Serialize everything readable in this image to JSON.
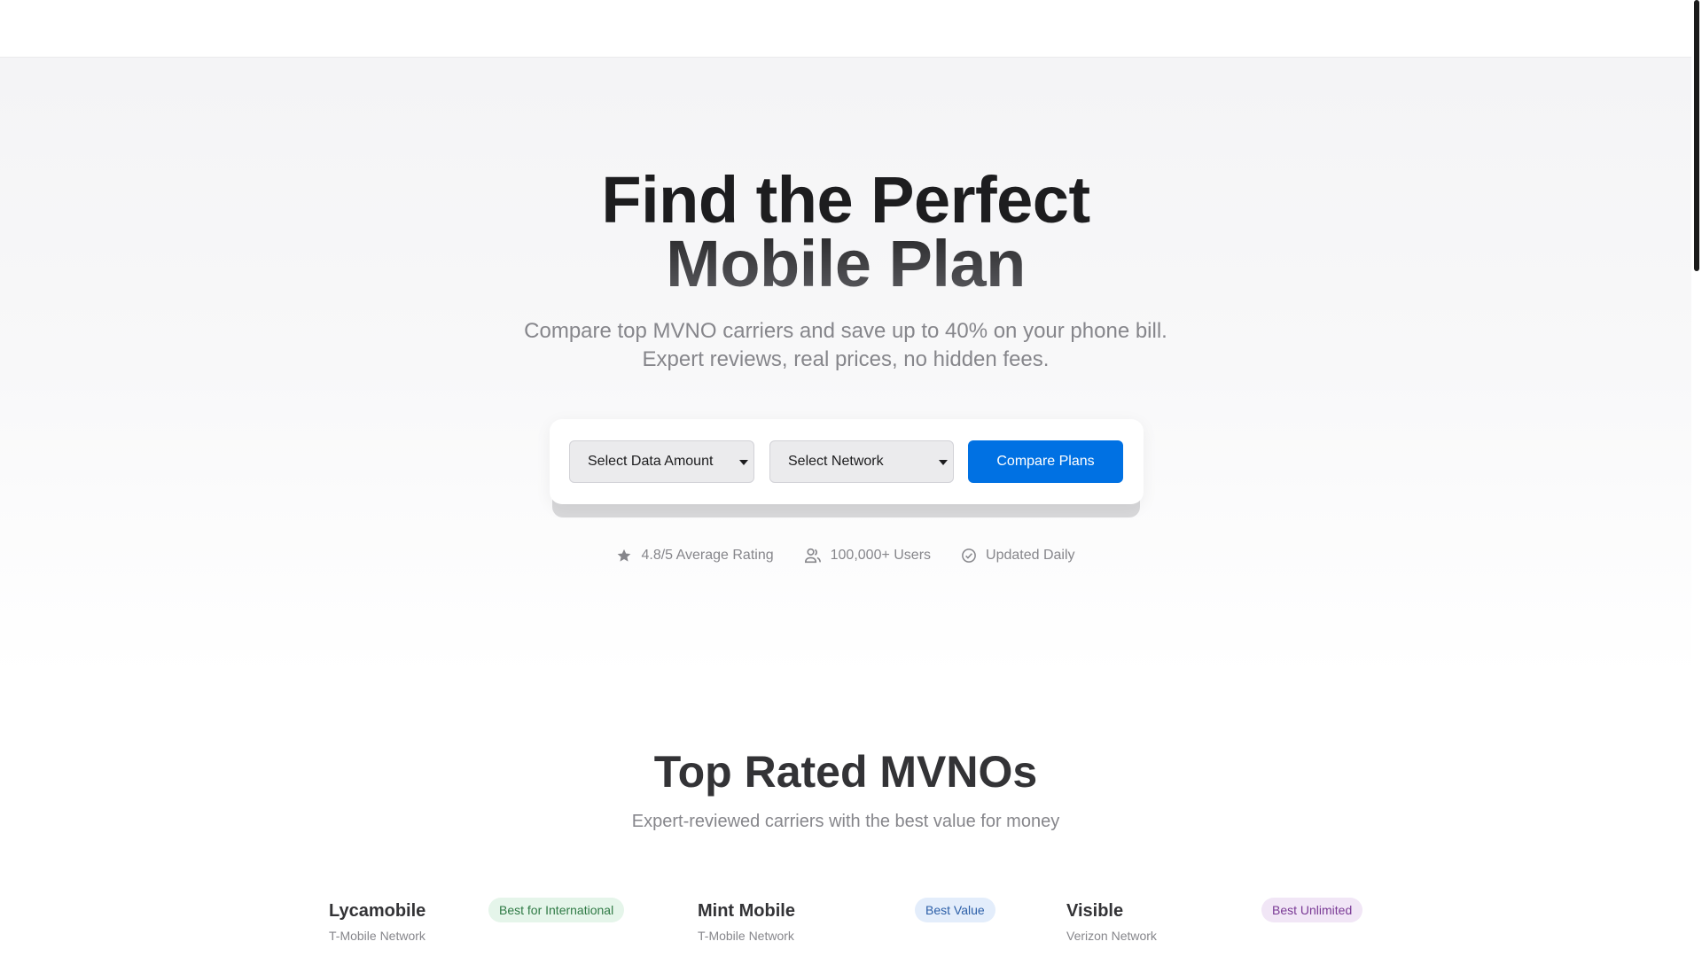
{
  "hero": {
    "title_line1": "Find the Perfect",
    "title_line2": "Mobile Plan",
    "subtitle_line1": "Compare top MVNO carriers and save up to 40% on your phone bill.",
    "subtitle_line2": "Expert reviews, real prices, no hidden fees."
  },
  "search": {
    "data_select": "Select Data Amount",
    "network_select": "Select Network",
    "compare_button": "Compare Plans"
  },
  "stats": [
    {
      "icon": "star-icon",
      "label": "4.8/5 Average Rating"
    },
    {
      "icon": "users-icon",
      "label": "100,000+ Users"
    },
    {
      "icon": "check-circle-icon",
      "label": "Updated Daily"
    }
  ],
  "top_rated": {
    "title": "Top Rated MVNOs",
    "subtitle": "Expert-reviewed carriers with the best value for money",
    "carriers": [
      {
        "name": "Lycamobile",
        "network": "T-Mobile Network",
        "badge": "Best for International",
        "badge_color": "#2f7a45"
      },
      {
        "name": "Mint Mobile",
        "network": "T-Mobile Network",
        "badge": "Best Value",
        "badge_color": "#2c5fa8"
      },
      {
        "name": "Visible",
        "network": "Verizon Network",
        "badge": "Best Unlimited",
        "badge_color": "#7a3a95"
      }
    ]
  },
  "colors": {
    "accent": "#0071e3",
    "text_primary": "#1d1d1f",
    "text_secondary": "#86868b"
  }
}
